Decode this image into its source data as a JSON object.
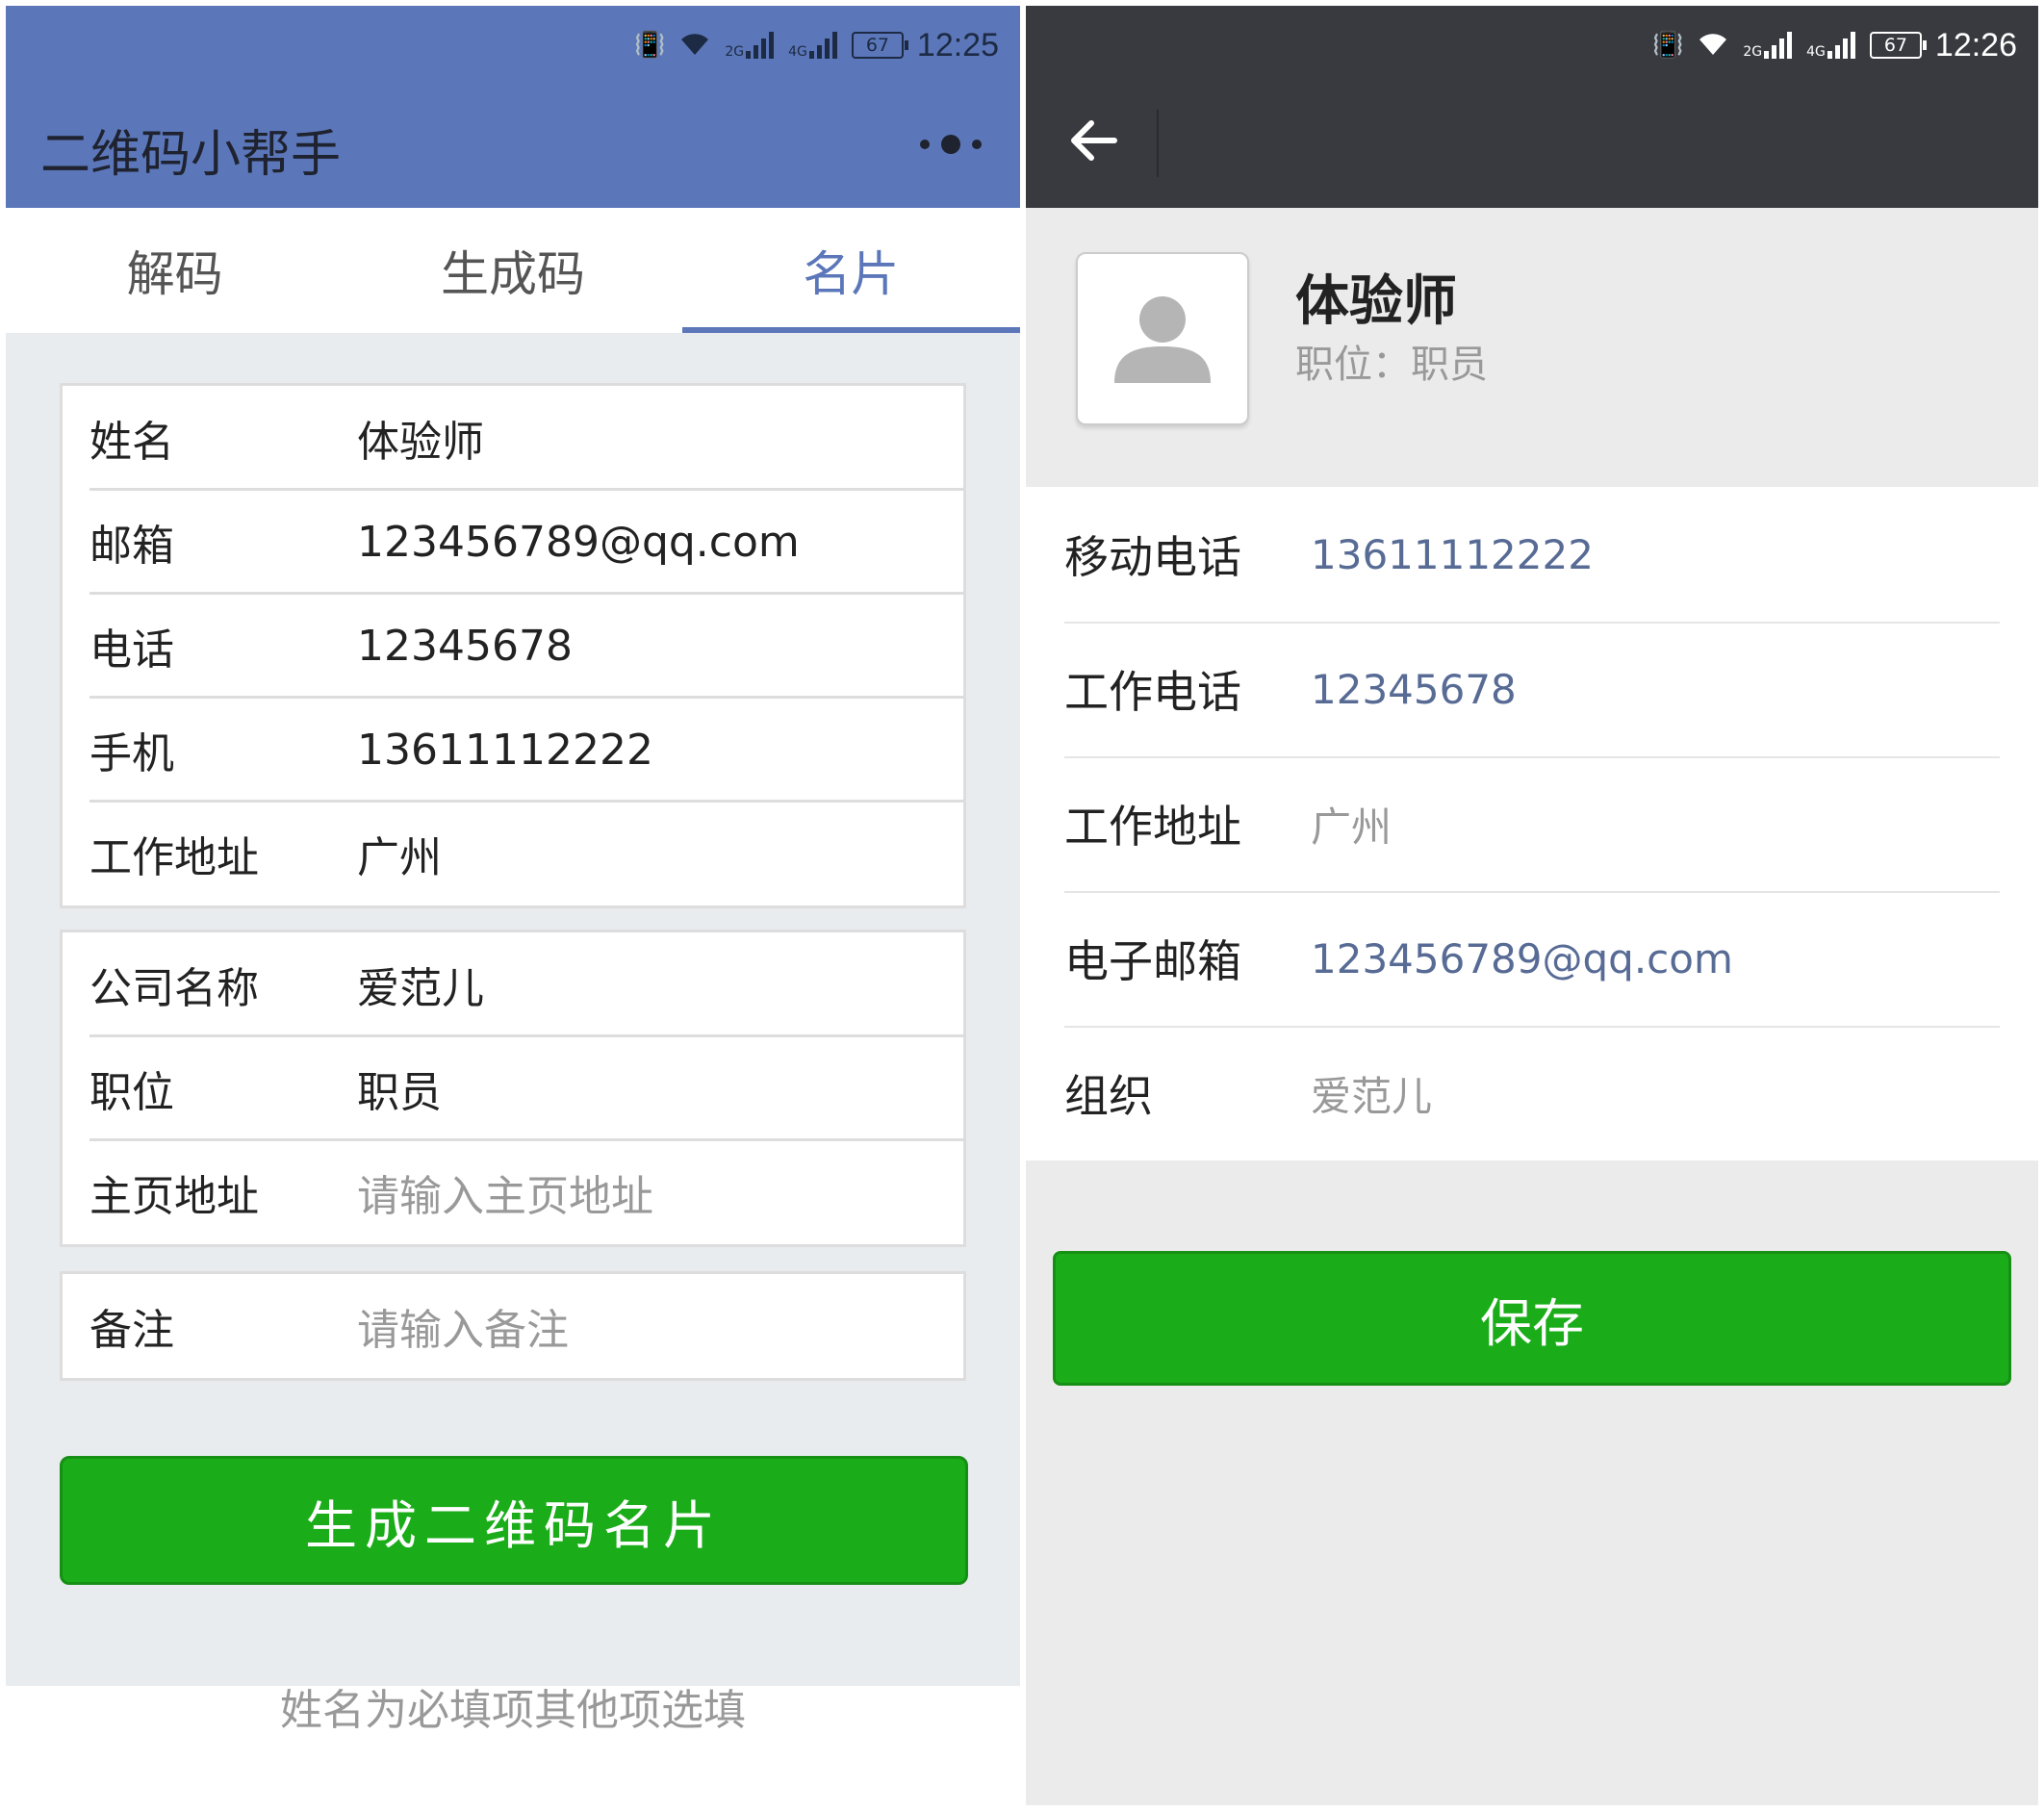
{
  "left": {
    "status": {
      "network_a": "2G",
      "network_b": "4G",
      "battery": "67",
      "time": "12:25"
    },
    "title": "二维码小帮手",
    "tabs": [
      {
        "label": "解码"
      },
      {
        "label": "生成码"
      },
      {
        "label": "名片"
      }
    ],
    "active_tab": "名片",
    "group1": [
      {
        "label": "姓名",
        "value": "体验师"
      },
      {
        "label": "邮箱",
        "value": "123456789@qq.com"
      },
      {
        "label": "电话",
        "value": "12345678"
      },
      {
        "label": "手机",
        "value": "13611112222"
      },
      {
        "label": "工作地址",
        "value": "广州"
      }
    ],
    "group2": [
      {
        "label": "公司名称",
        "value": "爱范儿"
      },
      {
        "label": "职位",
        "value": "职员"
      },
      {
        "label": "主页地址",
        "placeholder": "请输入主页地址"
      }
    ],
    "group3": [
      {
        "label": "备注",
        "placeholder": "请输入备注"
      }
    ],
    "generate_button": "生成二维码名片",
    "hint": "姓名为必填项其他项选填"
  },
  "right": {
    "status": {
      "network_a": "2G",
      "network_b": "4G",
      "battery": "67",
      "time": "12:26"
    },
    "profile": {
      "name": "体验师",
      "title_label": "职位：",
      "title_value": "职员"
    },
    "info": [
      {
        "label": "移动电话",
        "value": "13611112222"
      },
      {
        "label": "工作电话",
        "value": "12345678"
      },
      {
        "label": "工作地址",
        "value": "广州"
      },
      {
        "label": "电子邮箱",
        "value": "123456789@qq.com"
      },
      {
        "label": "组织",
        "value": "爱范儿"
      }
    ],
    "save_button": "保存"
  },
  "icons": {
    "vibrate": "vibrate-icon",
    "wifi": "wifi-icon",
    "signal": "signal-icon",
    "battery": "battery-icon",
    "more": "more-dots-icon",
    "back": "back-arrow-icon",
    "avatar": "person-avatar-icon"
  },
  "colors": {
    "header_blue": "#5b77b9",
    "header_dark": "#393a3f",
    "primary_green": "#1aad19",
    "link_blue": "#576b95",
    "muted_gray": "#999999"
  }
}
